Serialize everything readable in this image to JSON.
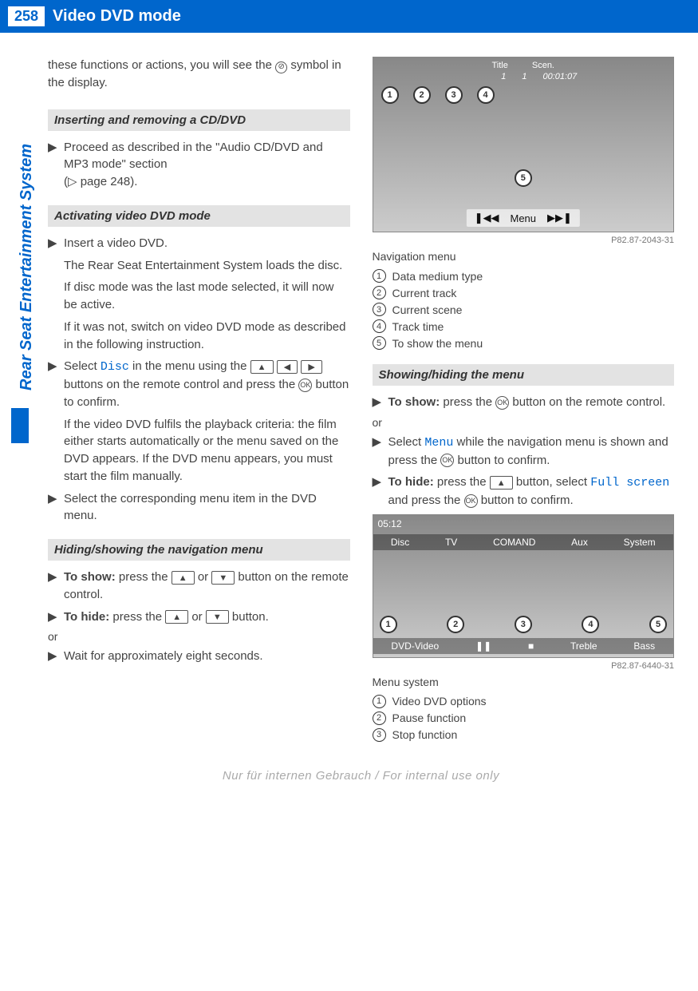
{
  "header": {
    "page_number": "258",
    "title": "Video DVD mode"
  },
  "side_tab": "Rear Seat Entertainment System",
  "left": {
    "intro_line1": "these functions or actions, you will see the",
    "intro_line2": " symbol in the display.",
    "sec1": {
      "title": "Inserting and removing a CD/DVD",
      "step1a": "Proceed as described in the \"Audio CD/DVD and MP3 mode\" section",
      "step1b": "(",
      "step1c": " page 248)."
    },
    "sec2": {
      "title": "Activating video DVD mode",
      "s1a": "Insert a video DVD.",
      "s1b": "The Rear Seat Entertainment System loads the disc.",
      "s1c": "If disc mode was the last mode selected, it will now be active.",
      "s1d": "If it was not, switch on video DVD mode as described in the following instruction.",
      "s2a": "Select ",
      "s2a_mono": "Disc",
      "s2b": " in the menu using the ",
      "s2c": " buttons on the remote control and press the ",
      "s2d": " button to confirm.",
      "s2e": "If the video DVD fulfils the playback criteria: the film either starts automatically or the menu saved on the DVD appears. If the DVD menu appears, you must start the film manually.",
      "s3": "Select the corresponding menu item in the DVD menu."
    },
    "sec3": {
      "title": "Hiding/showing the navigation menu",
      "show_label": "To show:",
      "show_a": " press the ",
      "show_b": " or ",
      "show_c": " button on the remote control.",
      "hide_label": "To hide:",
      "hide_a": " press the ",
      "hide_b": " or ",
      "hide_c": " button.",
      "or": "or",
      "wait": "Wait for approximately eight seconds."
    }
  },
  "right": {
    "fig1": {
      "top_title": "Title",
      "top_scen": "Scen.",
      "t1": "1",
      "t2": "1",
      "time": "00:01:07",
      "menu": "Menu",
      "code": "P82.87-2043-31",
      "caption": "Navigation menu",
      "c1": "Data medium type",
      "c2": "Current track",
      "c3": "Current scene",
      "c4": "Track time",
      "c5": "To show the menu"
    },
    "sec4": {
      "title": "Showing/hiding the menu",
      "show_label": "To show:",
      "show_a": " press the ",
      "show_b": " button on the remote control.",
      "or": "or",
      "s2a": "Select ",
      "s2a_mono": "Menu",
      "s2b": " while the navigation menu is shown and press the ",
      "s2c": " button to confirm.",
      "hide_label": "To hide:",
      "hide_a": " press the ",
      "hide_b": " button, select ",
      "hide_mono": "Full screen",
      "hide_c": " and press the ",
      "hide_d": " button to confirm."
    },
    "fig2": {
      "time": "05:12",
      "tabs": [
        "Disc",
        "TV",
        "COMAND",
        "Aux",
        "System"
      ],
      "bottom": [
        "DVD-Video",
        "❚❚",
        "■",
        "Treble",
        "Bass"
      ],
      "code": "P82.87-6440-31",
      "caption": "Menu system",
      "c1": "Video DVD options",
      "c2": "Pause function",
      "c3": "Stop function"
    }
  },
  "footer": "Nur für internen Gebrauch / For internal use only",
  "glyphs": {
    "ok": "OK",
    "up": "▲",
    "down": "▼",
    "left": "◀",
    "right": "▶",
    "tri": "▶",
    "prohibit": "⊘",
    "pageref": "▷",
    "prev": "❚◀◀",
    "next": "▶▶❚"
  }
}
